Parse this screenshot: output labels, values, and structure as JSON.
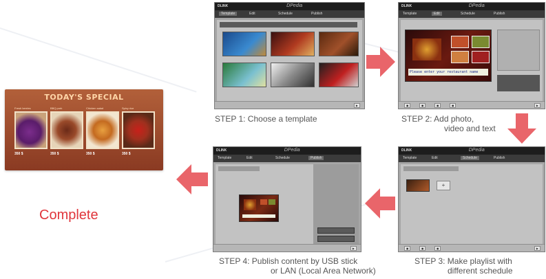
{
  "signage": {
    "title": "TODAY'S SPECIAL",
    "items": [
      {
        "caption": "Fresh berries",
        "price": "350 $"
      },
      {
        "caption": "BBQ pork",
        "price": "350 $"
      },
      {
        "caption": "Chicken salad",
        "price": "350 $"
      },
      {
        "caption": "Spicy rice",
        "price": "350 $"
      }
    ]
  },
  "complete_label": "Complete",
  "steps": [
    {
      "line1": "STEP 1: Choose a template",
      "line2": ""
    },
    {
      "line1": "STEP 2: Add photo,",
      "line2": "video and text"
    },
    {
      "line1": "STEP 3: Make playlist with",
      "line2": "different schedule"
    },
    {
      "line1": "STEP 4: Publish content by USB stick",
      "line2": "or LAN (Local Area Network)"
    }
  ],
  "app": {
    "logo": "DLINK",
    "name": "DPedia",
    "tabs": [
      "Template",
      "Edit",
      "Schedule",
      "Publish"
    ],
    "step2_banner_text": "Please enter your restaurant name"
  },
  "colors": {
    "accent_red": "#e0353b",
    "arrow": "#e9656a",
    "signage": "#9c4a2c"
  }
}
